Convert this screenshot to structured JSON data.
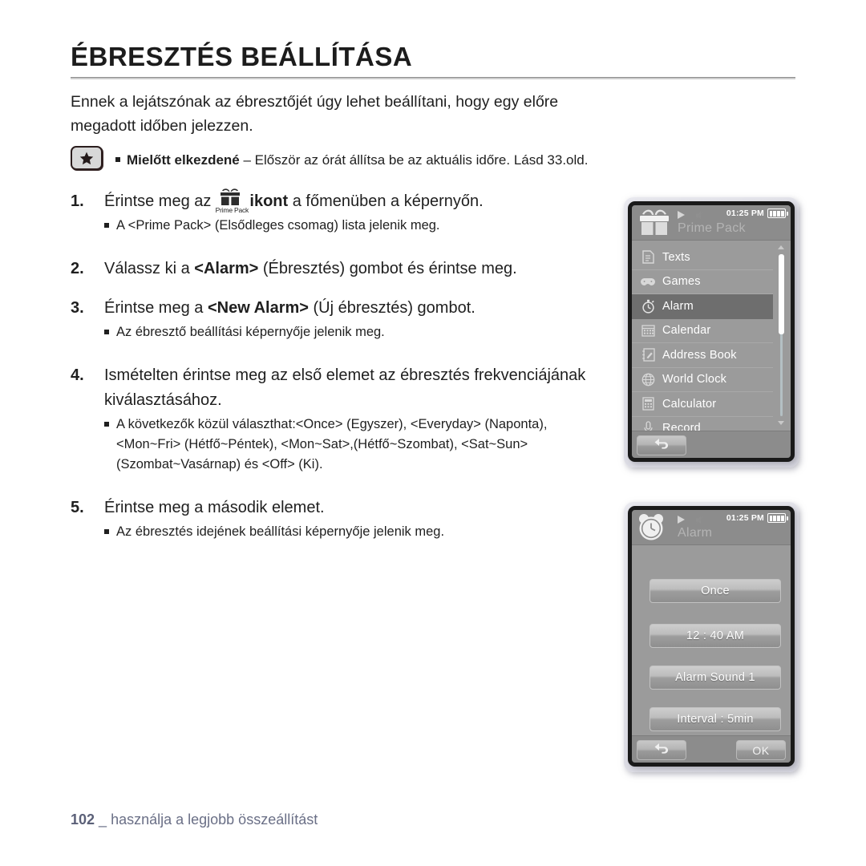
{
  "document": {
    "title": "ÉBRESZTÉS BEÁLLÍTÁSA",
    "intro": "Ennek a lejátszónak az ébresztőjét úgy lehet beállítani, hogy egy előre megadott időben jelezzen.",
    "note": {
      "icon": "star-badge-icon",
      "label_bold": "Mielőtt elkezdené",
      "dash": " – ",
      "text": "Először az órát állítsa be az aktuális időre. Lásd 33.old."
    },
    "footer": {
      "page_number": "102",
      "separator": " _ ",
      "text": "használja a legjobb összeállítást",
      "color": "#6a6f86"
    }
  },
  "steps": [
    {
      "number": "1.",
      "text_before": "Érintse meg az",
      "inline_icon": "prime-pack-gift-icon",
      "inline_icon_caption": "Prime Pack",
      "text_bold": "ikont",
      "text_after": "a főmenüben a képernyőn.",
      "bullets": [
        "A <Prime Pack> (Elsődleges csomag) lista jelenik meg."
      ]
    },
    {
      "number": "2.",
      "text_before": "Válassz ki a ",
      "text_bold": "<Alarm>",
      "text_after": " (Ébresztés) gombot és érintse meg.",
      "bullets": []
    },
    {
      "number": "3.",
      "text_before": "Érintse meg a ",
      "text_bold": "<New Alarm>",
      "text_after": " (Új ébresztés) gombot.",
      "bullets": [
        "Az ébresztő beállítási képernyője jelenik meg."
      ]
    },
    {
      "number": "4.",
      "text_before": "Ismételten érintse meg az első elemet az ébresztés frekvenciájának kiválasztásához.",
      "text_bold": "",
      "text_after": "",
      "bullets": [
        "A következők közül választhat:<Once> (Egyszer), <Everyday> (Naponta), <Mon~Fri> (Hétfő~Péntek), <Mon~Sat>,(Hétfő~Szombat), <Sat~Sun> (Szombat~Vasárnap) és <Off> (Ki)."
      ]
    },
    {
      "number": "5.",
      "text_before": "Érintse meg a második elemet.",
      "text_bold": "",
      "text_after": "",
      "bullets": [
        "Az ébresztés idejének beállítási képernyője jelenik meg."
      ]
    }
  ],
  "device_prime_pack": {
    "status_bar": {
      "play_icon": "play-icon",
      "mute_icon": "mute-icon",
      "time": "01:25 PM",
      "battery_icon": "battery-full-icon"
    },
    "header": {
      "icon": "gift-box-icon",
      "title": "Prime Pack"
    },
    "menu_items": [
      {
        "label": "Texts",
        "icon": "document-icon",
        "selected": false
      },
      {
        "label": "Games",
        "icon": "gamepad-icon",
        "selected": false
      },
      {
        "label": "Alarm",
        "icon": "stopwatch-icon",
        "selected": true
      },
      {
        "label": "Calendar",
        "icon": "calendar-icon",
        "selected": false
      },
      {
        "label": "Address Book",
        "icon": "address-book-icon",
        "selected": false
      },
      {
        "label": "World Clock",
        "icon": "globe-icon",
        "selected": false
      },
      {
        "label": "Calculator",
        "icon": "calculator-icon",
        "selected": false
      },
      {
        "label": "Record",
        "icon": "microphone-icon",
        "selected": false
      }
    ],
    "scrollbar": {
      "up_arrow": "chevron-up-icon",
      "down_arrow": "chevron-down-icon"
    },
    "soft_keys": {
      "back_icon": "back-arrow-icon"
    },
    "accent_selected": "#6e6e6e",
    "screen_background": "#9b9b9b"
  },
  "device_alarm": {
    "status_bar": {
      "play_icon": "play-icon",
      "mute_icon": "mute-icon",
      "time": "01:25 PM",
      "battery_icon": "battery-full-icon"
    },
    "header": {
      "icon": "alarm-clock-icon",
      "title": "Alarm"
    },
    "buttons": [
      {
        "label": "Once"
      },
      {
        "label": "12 : 40 AM"
      },
      {
        "label": "Alarm Sound 1"
      },
      {
        "label": "Interval : 5min"
      }
    ],
    "soft_keys": {
      "back_icon": "back-arrow-icon",
      "ok_label": "OK"
    },
    "screen_background": "#9b9b9b"
  }
}
